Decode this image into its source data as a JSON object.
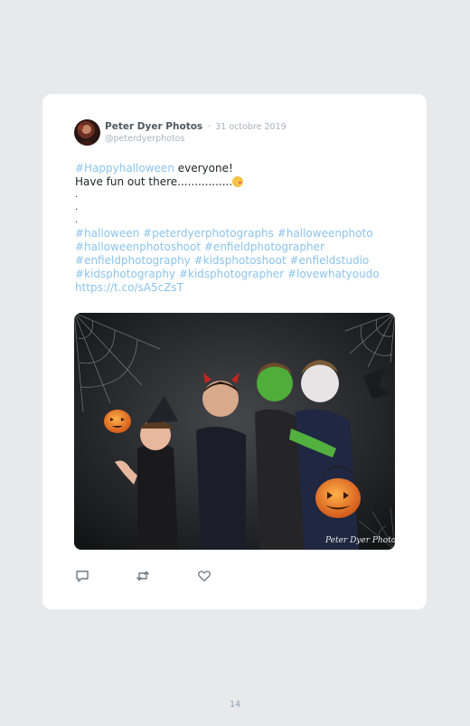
{
  "tweet": {
    "author": {
      "name": "Peter Dyer Photos",
      "separator": "·",
      "date": "31 octobre 2019",
      "handle": "@peterdyerphotos"
    },
    "text": {
      "line1_tag": "#Happyhalloween",
      "line1_rest": " everyone!",
      "line2": "Have fun out there................",
      "dots": [
        ".",
        ".",
        "."
      ],
      "hashtag_lines": [
        "#halloween #peterdyerphotographs #halloweenphoto",
        "#halloweenphotoshoot #enfieldphotographer",
        "#enfieldphotography #kidsphotoshoot #enfieldstudio",
        "#kidsphotography #kidsphotographer #lovewhatyoudo",
        "https://t.co/sA5cZsT"
      ]
    },
    "media": {
      "watermark": "Peter Dyer Photography"
    },
    "actions": {
      "reply_icon": "reply-icon",
      "retweet_icon": "retweet-icon",
      "like_icon": "heart-icon"
    }
  },
  "page": {
    "number": "14"
  },
  "colors": {
    "background": "#e8e9eb",
    "card": "#ffffff",
    "link": "#8cc4ec",
    "meta": "#a9b3bb"
  }
}
